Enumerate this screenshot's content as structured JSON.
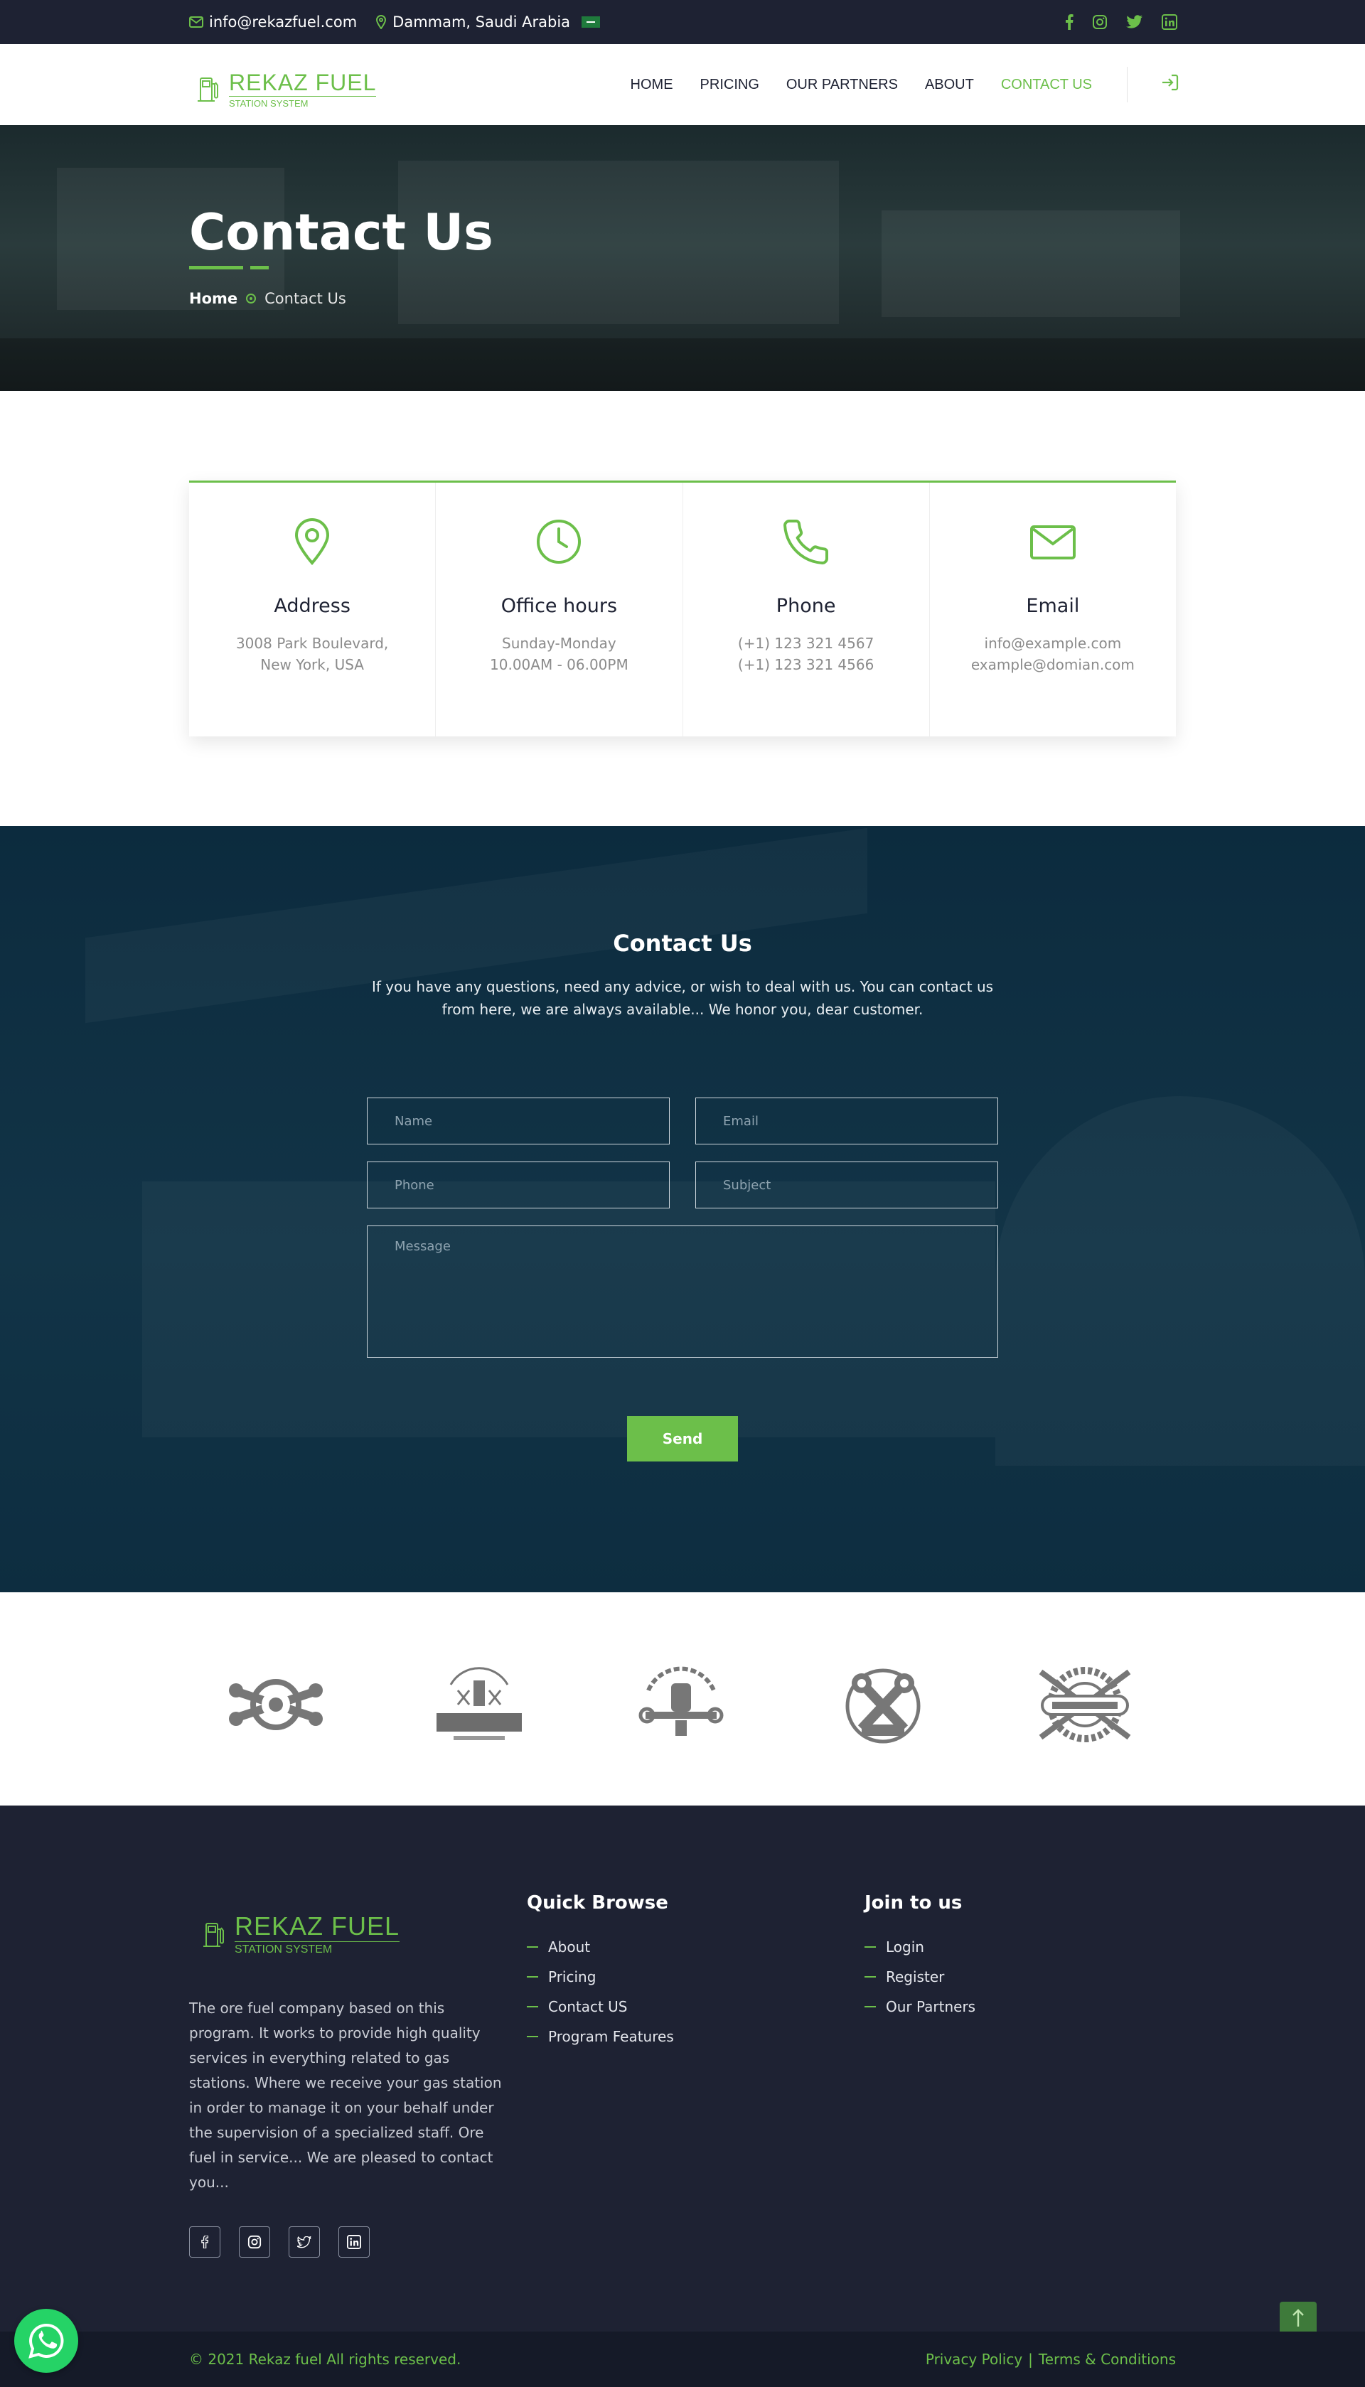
{
  "topbar": {
    "email": "info@rekazfuel.com",
    "location": "Dammam, Saudi Arabia",
    "social_icons": [
      "facebook-icon",
      "instagram-icon",
      "twitter-icon",
      "linkedin-icon"
    ]
  },
  "brand": {
    "name": "REKAZ FUEL",
    "tagline": "STATION SYSTEM",
    "accent": "#6cbf4a",
    "dark": "#1e2233"
  },
  "nav": {
    "items": [
      {
        "label": "HOME"
      },
      {
        "label": "PRICING"
      },
      {
        "label": "OUR PARTNERS"
      },
      {
        "label": "ABOUT"
      },
      {
        "label": "CONTACT US",
        "active": true
      }
    ],
    "login_icon": "sign-in-icon"
  },
  "hero": {
    "title": "Contact Us",
    "breadcrumb_home": "Home",
    "breadcrumb_current": "Contact Us"
  },
  "info_cards": [
    {
      "icon": "map-pin-icon",
      "title": "Address",
      "lines": [
        "3008 Park Boulevard,",
        "New York, USA"
      ]
    },
    {
      "icon": "clock-icon",
      "title": "Office hours",
      "lines": [
        "Sunday-Monday",
        "10.00AM - 06.00PM"
      ]
    },
    {
      "icon": "phone-icon",
      "title": "Phone",
      "lines": [
        "(+1) 123 321 4567",
        "(+1) 123 321 4566"
      ]
    },
    {
      "icon": "envelope-icon",
      "title": "Email",
      "lines": [
        "info@example.com",
        "example@domian.com"
      ]
    }
  ],
  "contact_form": {
    "heading": "Contact Us",
    "description": "If you have any questions, need any advice, or wish to deal with us. You can contact us from here, we are always available... We honor you, dear customer.",
    "name_placeholder": "Name",
    "email_placeholder": "Email",
    "phone_placeholder": "Phone",
    "subject_placeholder": "Subject",
    "message_placeholder": "Message",
    "send_label": "Send"
  },
  "partners": [
    {
      "icon": "mechanic-services-logo"
    },
    {
      "icon": "auto-service-mechanic-repair-logo"
    },
    {
      "icon": "auto-service-logo"
    },
    {
      "icon": "muscle-garage-logo"
    },
    {
      "icon": "tire-service-logo"
    }
  ],
  "footer": {
    "about": "The ore fuel company based on this program. It works to provide high quality services in everything related to gas stations. Where we receive your gas station in order to manage it on your behalf under the supervision of a specialized staff. Ore fuel in service... We are pleased to contact you...",
    "quick_browse": {
      "heading": "Quick Browse",
      "links": [
        "About",
        "Pricing",
        "Contact US",
        "Program Features"
      ]
    },
    "join": {
      "heading": "Join to us",
      "links": [
        "Login",
        "Register",
        "Our Partners"
      ]
    }
  },
  "bottom": {
    "copyright": "© 2021 Rekaz fuel All rights reserved.",
    "privacy": "Privacy Policy",
    "separator": "|",
    "terms": "Terms & Conditions"
  }
}
